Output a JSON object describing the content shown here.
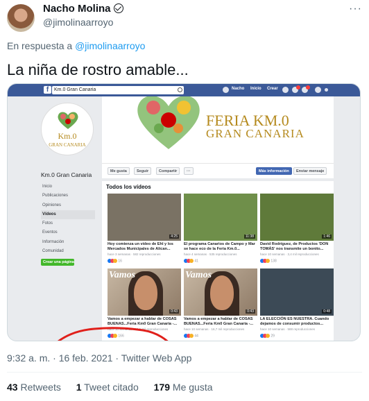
{
  "tweet": {
    "author_name": "Nacho Molina",
    "author_handle": "@jimolinaarroyo",
    "more_label": "···",
    "reply_prefix": "En respuesta a",
    "reply_handle": "@jimolinaarroyo",
    "text": "La niña de rostro amable...",
    "timestamp": "9:32 a. m. · 16 feb. 2021 · Twitter Web App",
    "retweets_count": "43",
    "retweets_label": "Retweets",
    "quotes_count": "1",
    "quotes_label": "Tweet citado",
    "likes_count": "179",
    "likes_label": "Me gusta"
  },
  "screenshot": {
    "search_value": "Km.0 Gran Canaria",
    "nav": {
      "user": "Nacho",
      "home": "Inicio",
      "create": "Crear"
    },
    "page_logo_title": "Km.0",
    "page_logo_subtitle": "GRAN CANARIA",
    "page_name": "Km.0 Gran Canaria",
    "left_nav": [
      "Inicio",
      "Publicaciones",
      "Opiniones",
      "Vídeos",
      "Fotos",
      "Eventos",
      "Información",
      "Comunidad"
    ],
    "create_page_label": "Crear una página",
    "cover_title_1": "FERIA KM.0",
    "cover_title_2": "GRAN CANARIA",
    "actions": {
      "like": "Me gusta",
      "follow": "Seguir",
      "share": "Compartir",
      "more": "···",
      "info": "Más información",
      "message": "Enviar mensaje"
    },
    "videos_heading": "Todos los vídeos",
    "videos": [
      {
        "title": "Hoy comienza un vídeo de Ehl y los Mercados Municipales de Alican...",
        "meta": "hace 3 semanas · 582 reproducciones",
        "reactions": "16",
        "duration": "4:25",
        "thumb": "#7a7264"
      },
      {
        "title": "El programa Canarios de Campo y Mar se hace eco de la Feria Km.0...",
        "meta": "hace 4 semanas · 535 reproducciones",
        "reactions": "41",
        "duration": "11:38",
        "thumb": "#6f8f4a"
      },
      {
        "title": "David Rodríguez, de Productos 'DON TOMÁS' nos transmite un bonito...",
        "meta": "hace 10 semanas · 3,4 mil reproducciones",
        "reactions": "138",
        "duration": "1:46",
        "thumb": "#5f7a3a"
      },
      {
        "title": "Vamos a empezar a hablar de COSAS BUENAS...Feria Km0 Gran Canaria -...",
        "meta": "hace 10 semanas · 19,5 mil reproducciones",
        "reactions": "166",
        "duration": "0:43",
        "thumb": "vamos"
      },
      {
        "title": "Vamos a empezar a hablar de COSAS BUENAS...Feria Km0 Gran Canaria -...",
        "meta": "hace 10 semanas · 16,7 mil reproducciones",
        "reactions": "44",
        "duration": "0:43",
        "thumb": "vamos"
      },
      {
        "title": "LA ELECCIÓN ES NUESTRA. Cuando dejamos de consumir productos...",
        "meta": "hace 10 semanas · 588 reproducciones",
        "reactions": "29",
        "duration": "0:48",
        "thumb": "#3c4a56"
      }
    ],
    "vamos_overlay": "Vamos"
  },
  "colors": {
    "twitter_blue": "#1d9bf0",
    "facebook_blue": "#3b5998",
    "annotation_red": "#e0201b"
  }
}
